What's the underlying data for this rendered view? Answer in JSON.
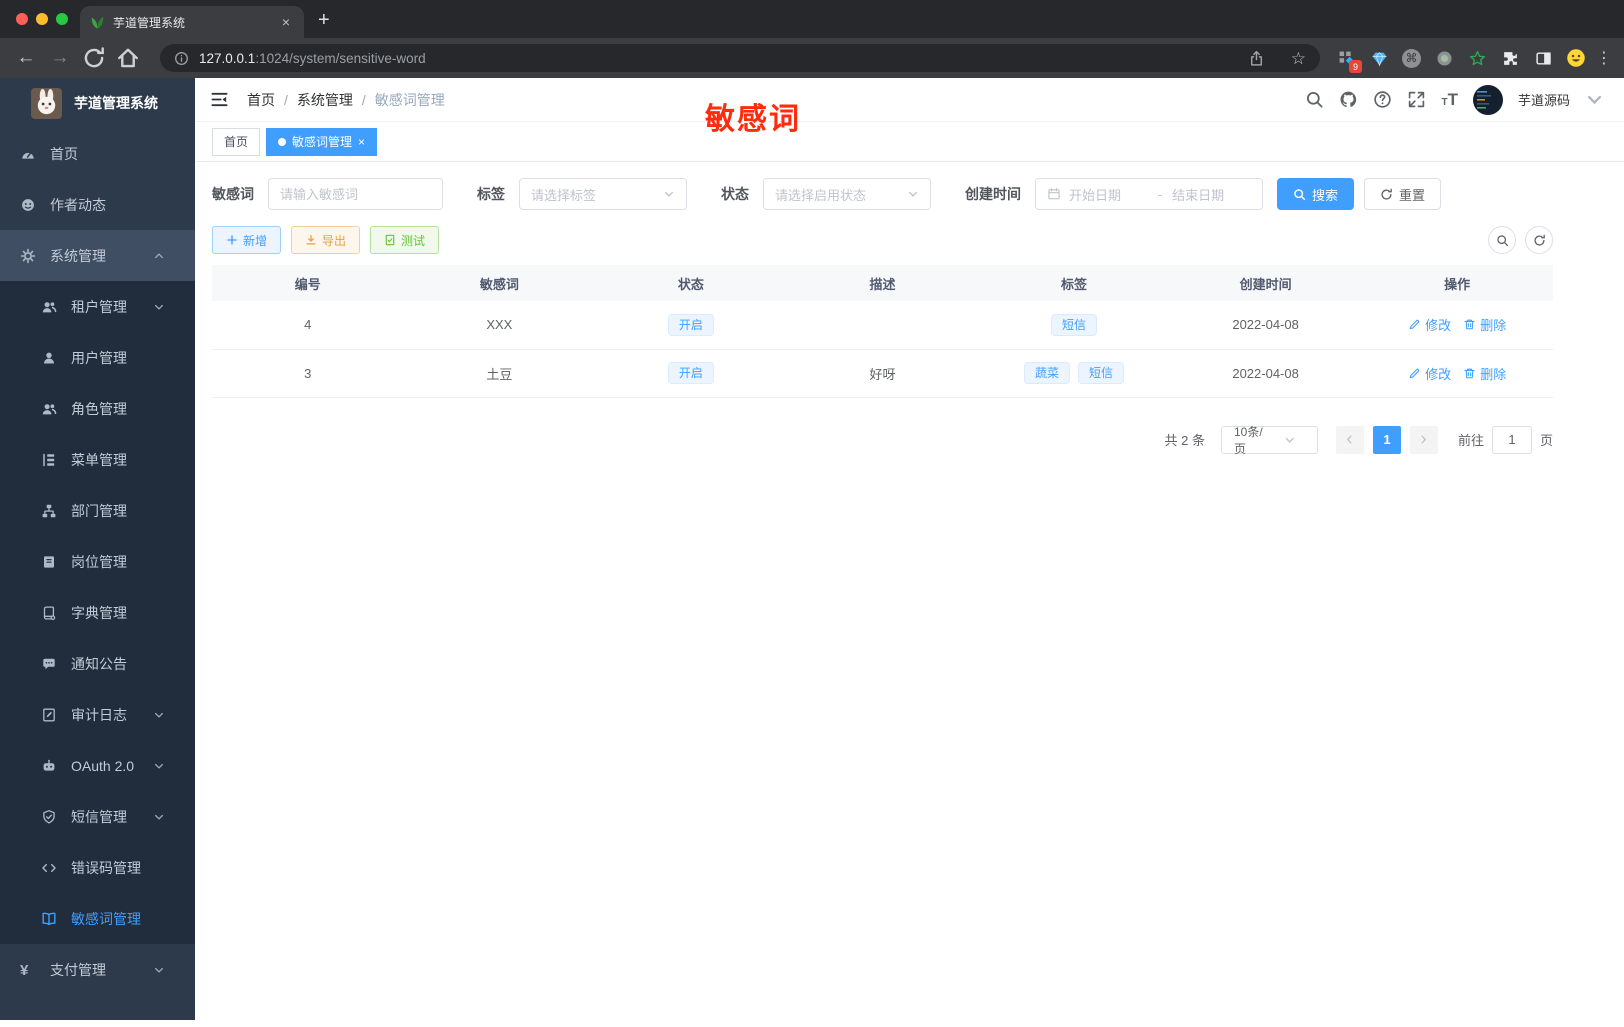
{
  "browser": {
    "tab_title": "芋道管理系统",
    "new_tab": "+",
    "close_tab": "×",
    "url_host": "127.0.0.1",
    "url_rest": ":1024/system/sensitive-word",
    "extension_badge": "9",
    "bookmark_star": "☆",
    "menu_dots": "⋮",
    "back_arrow": "←",
    "forward_arrow": "→",
    "cmd_glyph": "⌘"
  },
  "sidebar": {
    "logo_title": "芋道管理系统",
    "items": [
      {
        "id": "home",
        "label": "首页",
        "icon": "dashboard-icon",
        "type": "root"
      },
      {
        "id": "author",
        "label": "作者动态",
        "icon": "author-face-icon",
        "type": "root"
      },
      {
        "id": "system",
        "label": "系统管理",
        "icon": "gear-icon",
        "type": "root-open",
        "arrow": "up"
      },
      {
        "id": "tenant",
        "label": "租户管理",
        "icon": "tenant-users-icon",
        "type": "sub",
        "arrow": "down"
      },
      {
        "id": "user",
        "label": "用户管理",
        "icon": "user-icon",
        "type": "sub"
      },
      {
        "id": "role",
        "label": "角色管理",
        "icon": "role-users-icon",
        "type": "sub"
      },
      {
        "id": "menu",
        "label": "菜单管理",
        "icon": "menu-tree-icon",
        "type": "sub"
      },
      {
        "id": "dept",
        "label": "部门管理",
        "icon": "org-chart-icon",
        "type": "sub"
      },
      {
        "id": "post",
        "label": "岗位管理",
        "icon": "badge-icon",
        "type": "sub"
      },
      {
        "id": "dict",
        "label": "字典管理",
        "icon": "dictionary-icon",
        "type": "sub"
      },
      {
        "id": "notice",
        "label": "通知公告",
        "icon": "notice-bubble-icon",
        "type": "sub"
      },
      {
        "id": "audit",
        "label": "审计日志",
        "icon": "audit-log-icon",
        "type": "sub",
        "arrow": "down"
      },
      {
        "id": "oauth",
        "label": "OAuth 2.0",
        "icon": "robot-icon",
        "type": "sub",
        "arrow": "down"
      },
      {
        "id": "sms",
        "label": "短信管理",
        "icon": "shield-check-icon",
        "type": "sub",
        "arrow": "down"
      },
      {
        "id": "errcode",
        "label": "错误码管理",
        "icon": "code-brackets-icon",
        "type": "sub"
      },
      {
        "id": "sensitive",
        "label": "敏感词管理",
        "icon": "open-book-icon",
        "type": "sub",
        "active": true
      },
      {
        "id": "pay",
        "label": "支付管理",
        "icon": "yen-icon",
        "type": "root",
        "arrow": "down"
      }
    ]
  },
  "header": {
    "breadcrumb": [
      "首页",
      "系统管理",
      "敏感词管理"
    ],
    "annotation": "敏感词",
    "user_name": "芋道源码"
  },
  "tabs": [
    {
      "label": "首页",
      "active": false
    },
    {
      "label": "敏感词管理",
      "active": true,
      "closable": true
    }
  ],
  "filters": {
    "keyword_label": "敏感词",
    "keyword_placeholder": "请输入敏感词",
    "tag_label": "标签",
    "tag_placeholder": "请选择标签",
    "status_label": "状态",
    "status_placeholder": "请选择启用状态",
    "date_label": "创建时间",
    "date_start_placeholder": "开始日期",
    "date_separator": "-",
    "date_end_placeholder": "结束日期",
    "search_label": "搜索",
    "reset_label": "重置"
  },
  "toolbar": {
    "add_label": "新增",
    "export_label": "导出",
    "test_label": "测试"
  },
  "table": {
    "columns": [
      "编号",
      "敏感词",
      "状态",
      "描述",
      "标签",
      "创建时间",
      "操作"
    ],
    "edit_label": "修改",
    "delete_label": "删除",
    "rows": [
      {
        "id": "4",
        "word": "XXX",
        "status": "开启",
        "description": "",
        "tags": [
          "短信"
        ],
        "created": "2022-04-08"
      },
      {
        "id": "3",
        "word": "土豆",
        "status": "开启",
        "description": "好呀",
        "tags": [
          "蔬菜",
          "短信"
        ],
        "created": "2022-04-08"
      }
    ]
  },
  "pagination": {
    "total_text": "共 2 条",
    "page_size": "10条/页",
    "current_page": "1",
    "goto_label": "前往",
    "goto_value": "1",
    "page_suffix": "页"
  },
  "colors": {
    "accent": "#409eff",
    "sidebar_bg": "#2d3a4b",
    "submenu_bg": "#212c3d",
    "annotation_red": "#fe2b0d",
    "tag_bg": "#ecf5ff",
    "tab_active": "#409eff"
  }
}
